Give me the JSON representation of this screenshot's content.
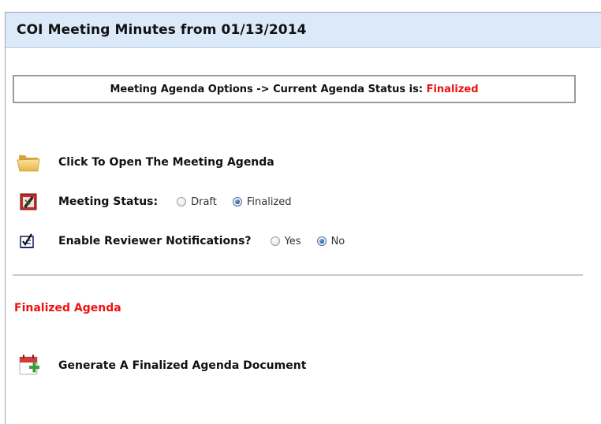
{
  "page": {
    "title": "COI Meeting Minutes from 01/13/2014"
  },
  "agenda_status": {
    "prefix": "Meeting Agenda Options -> Current Agenda Status is: ",
    "value": "Finalized"
  },
  "actions": {
    "open_agenda": {
      "label": "Click To Open The Meeting Agenda",
      "icon": "folder-icon"
    },
    "meeting_status": {
      "label": "Meeting Status:",
      "icon": "notepad-pencil-icon",
      "options": [
        {
          "label": "Draft",
          "selected": false
        },
        {
          "label": "Finalized",
          "selected": true
        }
      ]
    },
    "notifications": {
      "label": "Enable Reviewer Notifications?",
      "icon": "checklist-icon",
      "options": [
        {
          "label": "Yes",
          "selected": false
        },
        {
          "label": "No",
          "selected": true
        }
      ]
    }
  },
  "finalized": {
    "heading": "Finalized Agenda",
    "generate": {
      "label": "Generate A Finalized Agenda Document",
      "icon": "calendar-add-icon"
    }
  },
  "colors": {
    "header_bg": "#dce9f8",
    "accent_red": "#ee1111",
    "radio_selected": "#1d4f9b"
  }
}
